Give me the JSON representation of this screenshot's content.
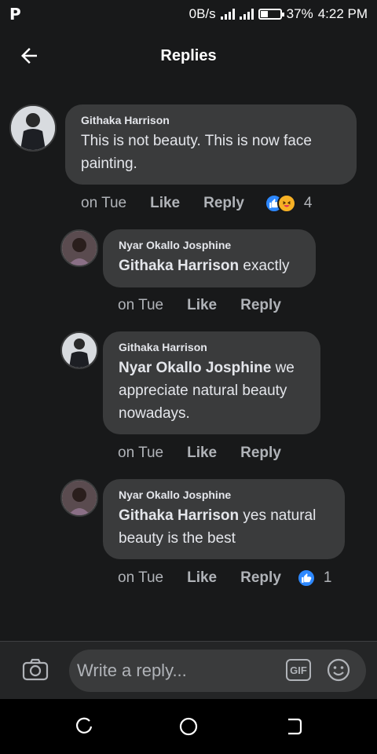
{
  "status_bar": {
    "app_logo": "P",
    "net_speed": "0B/s",
    "battery": "37%",
    "battery_level": 0.37,
    "time": "4:22 PM"
  },
  "header": {
    "title": "Replies"
  },
  "comments": [
    {
      "author": "Githaka Harrison",
      "mention": "",
      "text": "This is not beauty. This is now face painting.",
      "time": "on Tue",
      "like_label": "Like",
      "reply_label": "Reply",
      "reactions": [
        "like",
        "haha"
      ],
      "reaction_count": "4"
    },
    {
      "author": "Nyar Okallo Josphine",
      "mention": "Githaka Harrison",
      "text": "exactly",
      "time": "on Tue",
      "like_label": "Like",
      "reply_label": "Reply",
      "reactions": [],
      "reaction_count": ""
    },
    {
      "author": "Githaka Harrison",
      "mention": "Nyar Okallo Josphine",
      "text": "we appreciate natural beauty nowadays.",
      "time": "on Tue",
      "like_label": "Like",
      "reply_label": "Reply",
      "reactions": [],
      "reaction_count": ""
    },
    {
      "author": "Nyar Okallo Josphine",
      "mention": "Githaka Harrison",
      "text": "yes natural beauty is the best",
      "time": "on Tue",
      "like_label": "Like",
      "reply_label": "Reply",
      "reactions": [
        "like"
      ],
      "reaction_count": "1"
    }
  ],
  "composer": {
    "placeholder": "Write a reply...",
    "gif_label": "GIF"
  },
  "colors": {
    "background": "#18191a",
    "bubble": "#3a3b3c",
    "like_blue": "#2d88ff",
    "haha_yellow": "#f7b125"
  }
}
